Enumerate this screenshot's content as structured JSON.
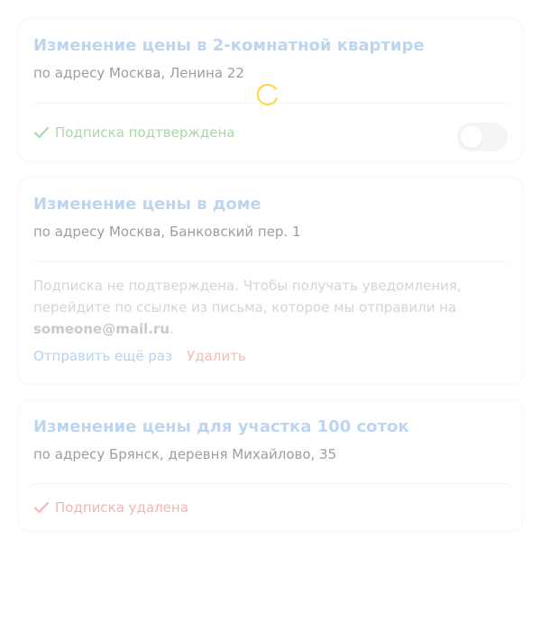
{
  "colors": {
    "title": "#bcd6f1",
    "confirmed": "#a8d8ab",
    "deleted": "#f5b5b5",
    "spinner": "#ffd642"
  },
  "loading": true,
  "subscriptions": [
    {
      "title": "Изменение цены в 2-комнатной квартире",
      "address": "по адресу Москва, Ленина 22",
      "status_icon": "check-icon",
      "status_text": "Подписка подтверждена",
      "toggle_on": false
    },
    {
      "title": "Изменение цены в доме",
      "address": "по адресу Москва, Банковский пер. 1",
      "note_text": "Подписка не подтверждена. Чтобы получать уведомления, перейдите по ссылке из письма, которое мы отправили на",
      "email": "someone@mail.ru",
      "note_end": ".",
      "resend_label": "Отправить ещё раз",
      "delete_label": "Удалить"
    },
    {
      "title": "Изменение цены для участка 100 соток",
      "address": "по адресу Брянск, деревня Михайлово, 35",
      "status_icon": "check-icon",
      "status_text": "Подписка удалена"
    }
  ]
}
